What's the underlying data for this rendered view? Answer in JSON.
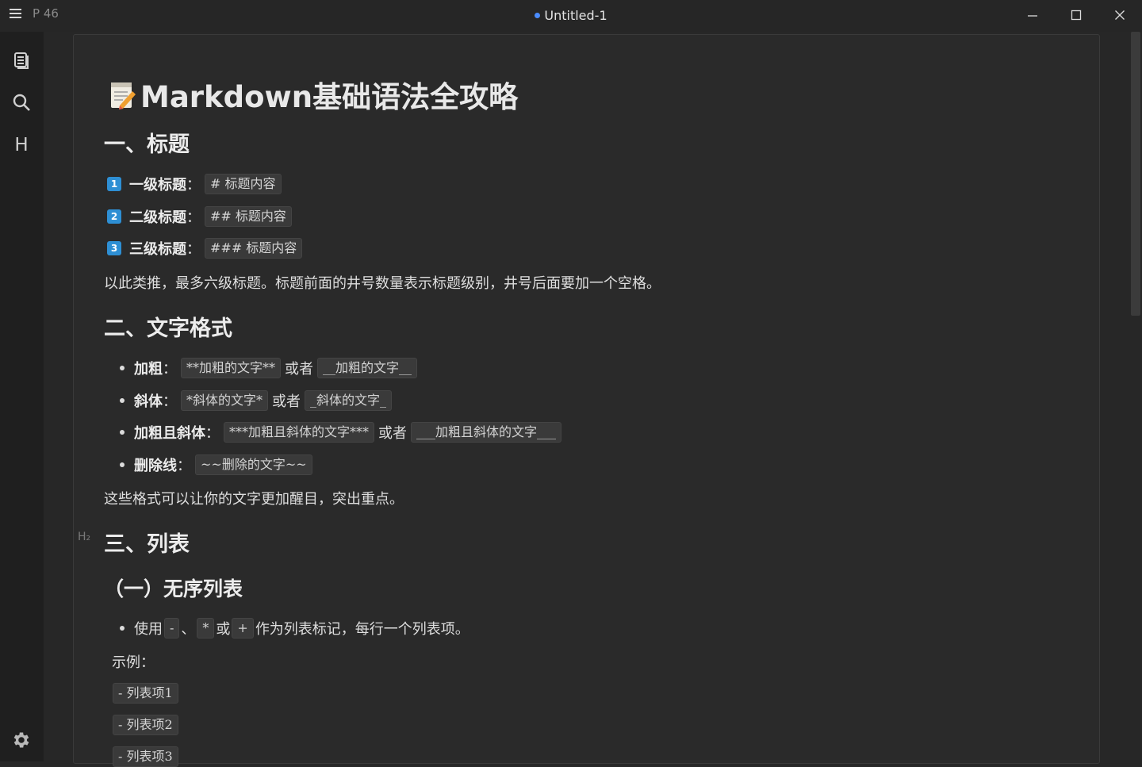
{
  "titlebar": {
    "word_count": "P 46",
    "title": "Untitled-1",
    "unsaved_color": "#4a8cff"
  },
  "sidebar": {
    "icons": [
      "files-icon",
      "search-icon",
      "heading-outline-icon",
      "settings-icon"
    ],
    "heading_glyph": "H"
  },
  "doc": {
    "h1": "Markdown基础语法全攻略",
    "sec1": {
      "title": "一、标题",
      "items": [
        {
          "num": "1",
          "label": "一级标题",
          "code": "# 标题内容"
        },
        {
          "num": "2",
          "label": "二级标题",
          "code": "## 标题内容"
        },
        {
          "num": "3",
          "label": "三级标题",
          "code": "### 标题内容"
        }
      ],
      "note": "以此类推，最多六级标题。标题前面的井号数量表示标题级别，井号后面要加一个空格。"
    },
    "sec2": {
      "title": "二、文字格式",
      "colon": "：",
      "or": "或者",
      "bold": {
        "label": "加粗",
        "code1": "**加粗的文字**",
        "code2": "__加粗的文字__"
      },
      "italic": {
        "label": "斜体",
        "code1": "*斜体的文字*",
        "code2": "_斜体的文字_"
      },
      "bolditalic": {
        "label": "加粗且斜体",
        "code1": "***加粗且斜体的文字***",
        "code2": "___加粗且斜体的文字___"
      },
      "strike": {
        "label": "删除线",
        "code1": "~~删除的文字~~"
      },
      "note": "这些格式可以让你的文字更加醒目，突出重点。"
    },
    "sec3": {
      "marker": "H₂",
      "title": "三、列表",
      "sub1": "（一）无序列表",
      "use_text": "使用",
      "sep": "、",
      "or": "或",
      "tail": "作为列表标记，每行一个列表项。",
      "marks": [
        "-",
        "*",
        "+"
      ],
      "example_label": "示例：",
      "examples": [
        "- 列表项1",
        "- 列表项2",
        "- 列表项3"
      ]
    }
  }
}
